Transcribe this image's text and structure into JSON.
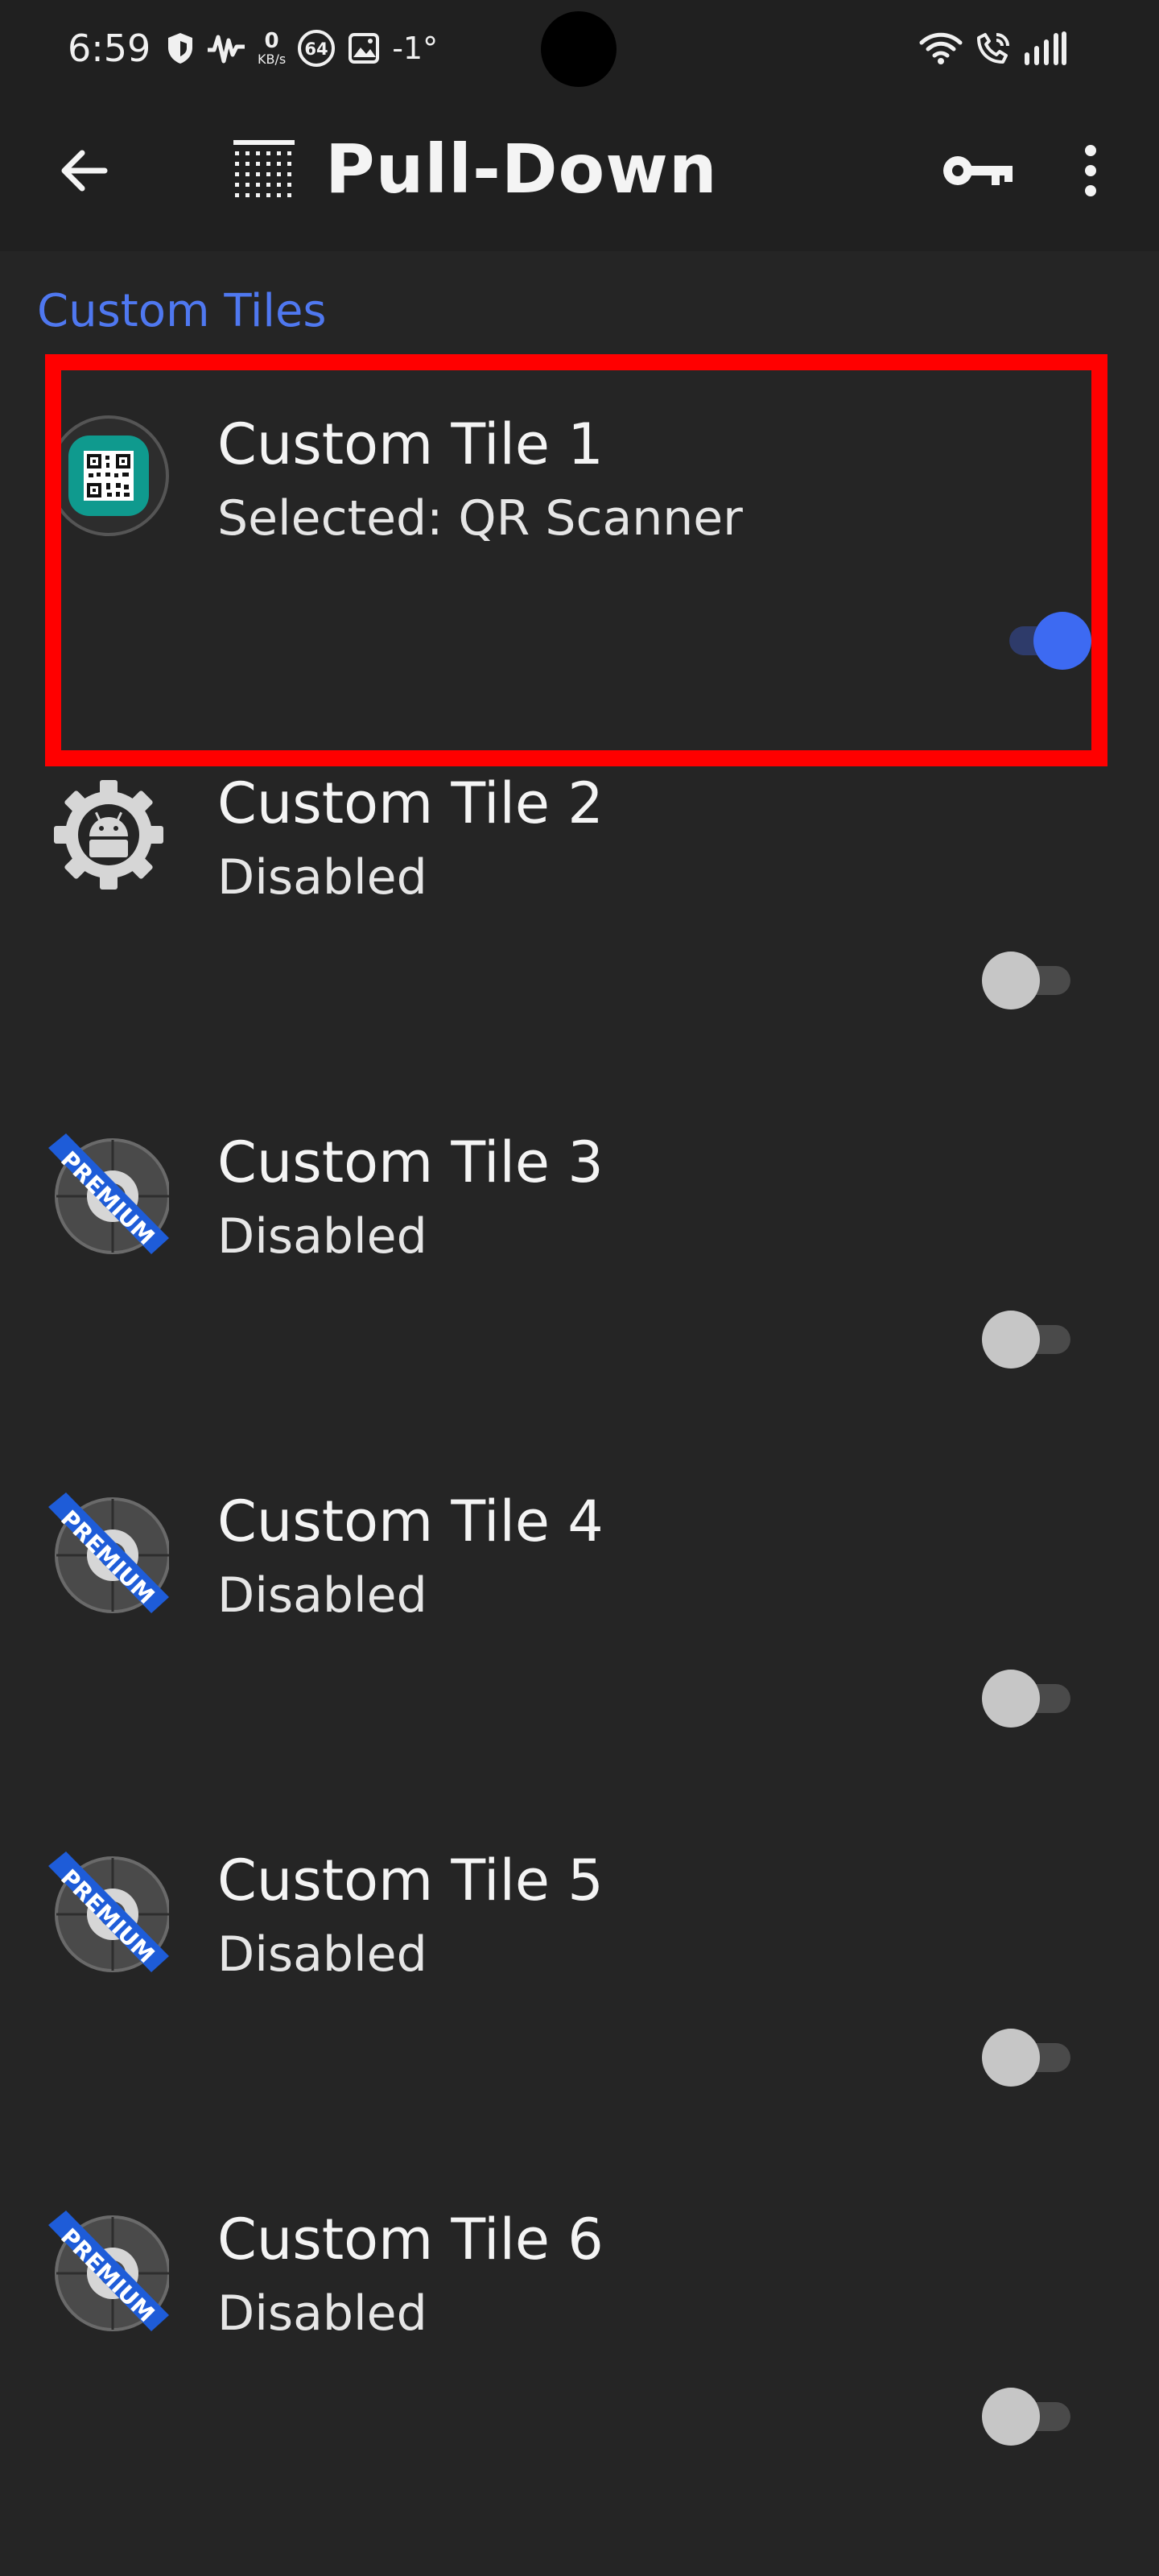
{
  "status_bar": {
    "time": "6:59",
    "net_speed_value": "0",
    "net_speed_unit": "KB/s",
    "badge_count": "64",
    "temperature": "-1°"
  },
  "app_bar": {
    "title": "Pull-Down"
  },
  "section": {
    "header": "Custom Tiles"
  },
  "tiles": [
    {
      "title": "Custom Tile 1",
      "subtitle": "Selected: QR Scanner",
      "enabled": true,
      "icon": "qr-scanner-icon"
    },
    {
      "title": "Custom Tile 2",
      "subtitle": "Disabled",
      "enabled": false,
      "icon": "android-gear-icon"
    },
    {
      "title": "Custom Tile 3",
      "subtitle": "Disabled",
      "enabled": false,
      "icon": "premium-icon"
    },
    {
      "title": "Custom Tile 4",
      "subtitle": "Disabled",
      "enabled": false,
      "icon": "premium-icon"
    },
    {
      "title": "Custom Tile 5",
      "subtitle": "Disabled",
      "enabled": false,
      "icon": "premium-icon"
    },
    {
      "title": "Custom Tile 6",
      "subtitle": "Disabled",
      "enabled": false,
      "icon": "premium-icon"
    }
  ],
  "premium_badge_text": "PREMIUM",
  "colors": {
    "background": "#252525",
    "accent": "#3d6af2",
    "section_header": "#4f78f0",
    "highlight": "#ff0000",
    "qr_icon": "#0f9a8e"
  }
}
